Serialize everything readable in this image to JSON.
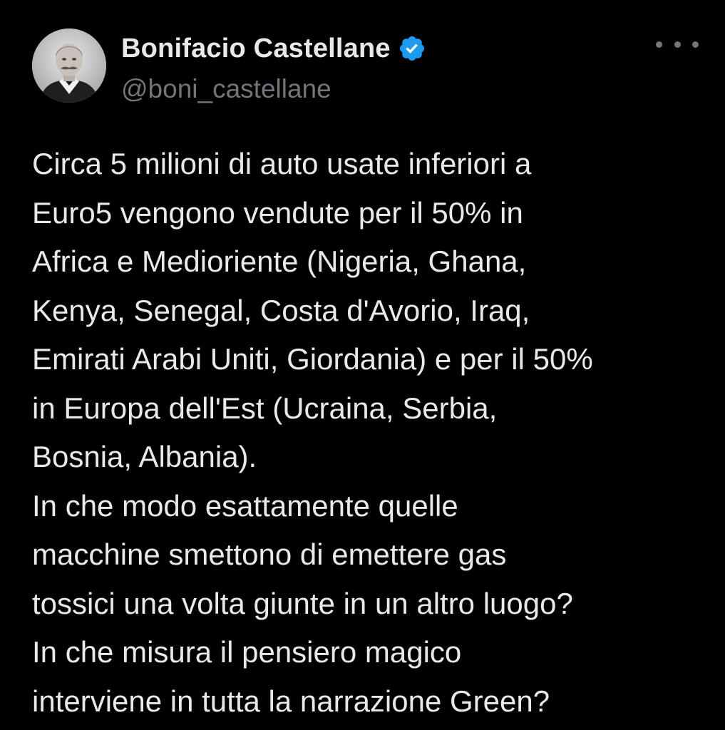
{
  "tweet": {
    "author": {
      "display_name": "Bonifacio Castellane",
      "handle": "@boni_castellane",
      "verified": true,
      "verified_icon": "verified-badge-icon",
      "verified_color": "#1d9bf0"
    },
    "more_icon": "more-options-icon",
    "lines": [
      "Circa 5 milioni di auto usate inferiori a",
      "Euro5 vengono vendute per il 50% in",
      "Africa e Medioriente (Nigeria, Ghana,",
      "Kenya, Senegal, Costa d'Avorio, Iraq,",
      "Emirati Arabi Uniti, Giordania) e per il 50%",
      "in Europa dell'Est (Ucraina, Serbia,",
      "Bosnia, Albania).",
      "In che modo esattamente quelle",
      "macchine smettono di emettere gas",
      "tossici una volta giunte in un altro luogo?",
      "In che misura il pensiero magico",
      "interviene in tutta la narrazione Green?"
    ]
  },
  "colors": {
    "background": "#000000",
    "text_primary": "#e7e9ea",
    "text_secondary": "#71767b",
    "accent": "#1d9bf0"
  }
}
